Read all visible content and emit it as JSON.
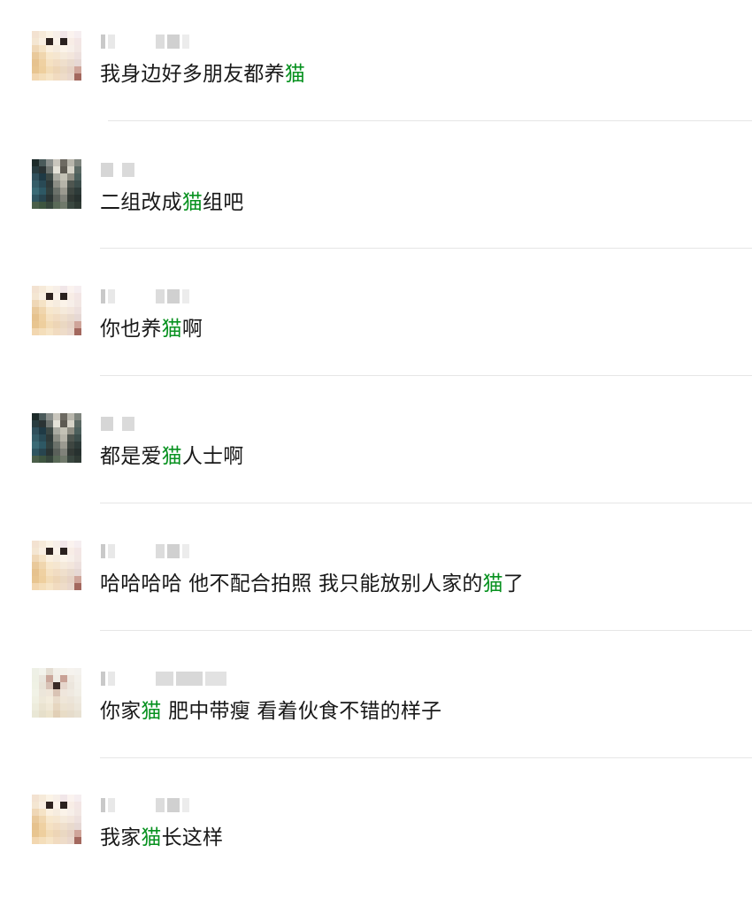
{
  "results": [
    {
      "sender": "",
      "avatar": "avatar-a",
      "before": "我身边好多朋友都养",
      "keyword": "猫",
      "after": ""
    },
    {
      "sender": "",
      "avatar": "avatar-b",
      "before": "二组改成",
      "keyword": "猫",
      "after": "组吧"
    },
    {
      "sender": "",
      "avatar": "avatar-a",
      "before": "你也养",
      "keyword": "猫",
      "after": "啊"
    },
    {
      "sender": "",
      "avatar": "avatar-b",
      "before": "都是爱",
      "keyword": "猫",
      "after": "人士啊"
    },
    {
      "sender": "",
      "avatar": "avatar-a",
      "before": "哈哈哈哈 他不配合拍照 我只能放别人家的",
      "keyword": "猫",
      "after": "了"
    },
    {
      "sender": "",
      "avatar": "avatar-c",
      "before": "你家",
      "keyword": "猫",
      "after": " 肥中带瘦 看着伙食不错的样子"
    },
    {
      "sender": "",
      "avatar": "avatar-a",
      "before": "我家",
      "keyword": "猫",
      "after": "长这样"
    }
  ],
  "colors": {
    "highlight": "#07911f",
    "text": "#191919",
    "divider": "#e6e6e6"
  }
}
